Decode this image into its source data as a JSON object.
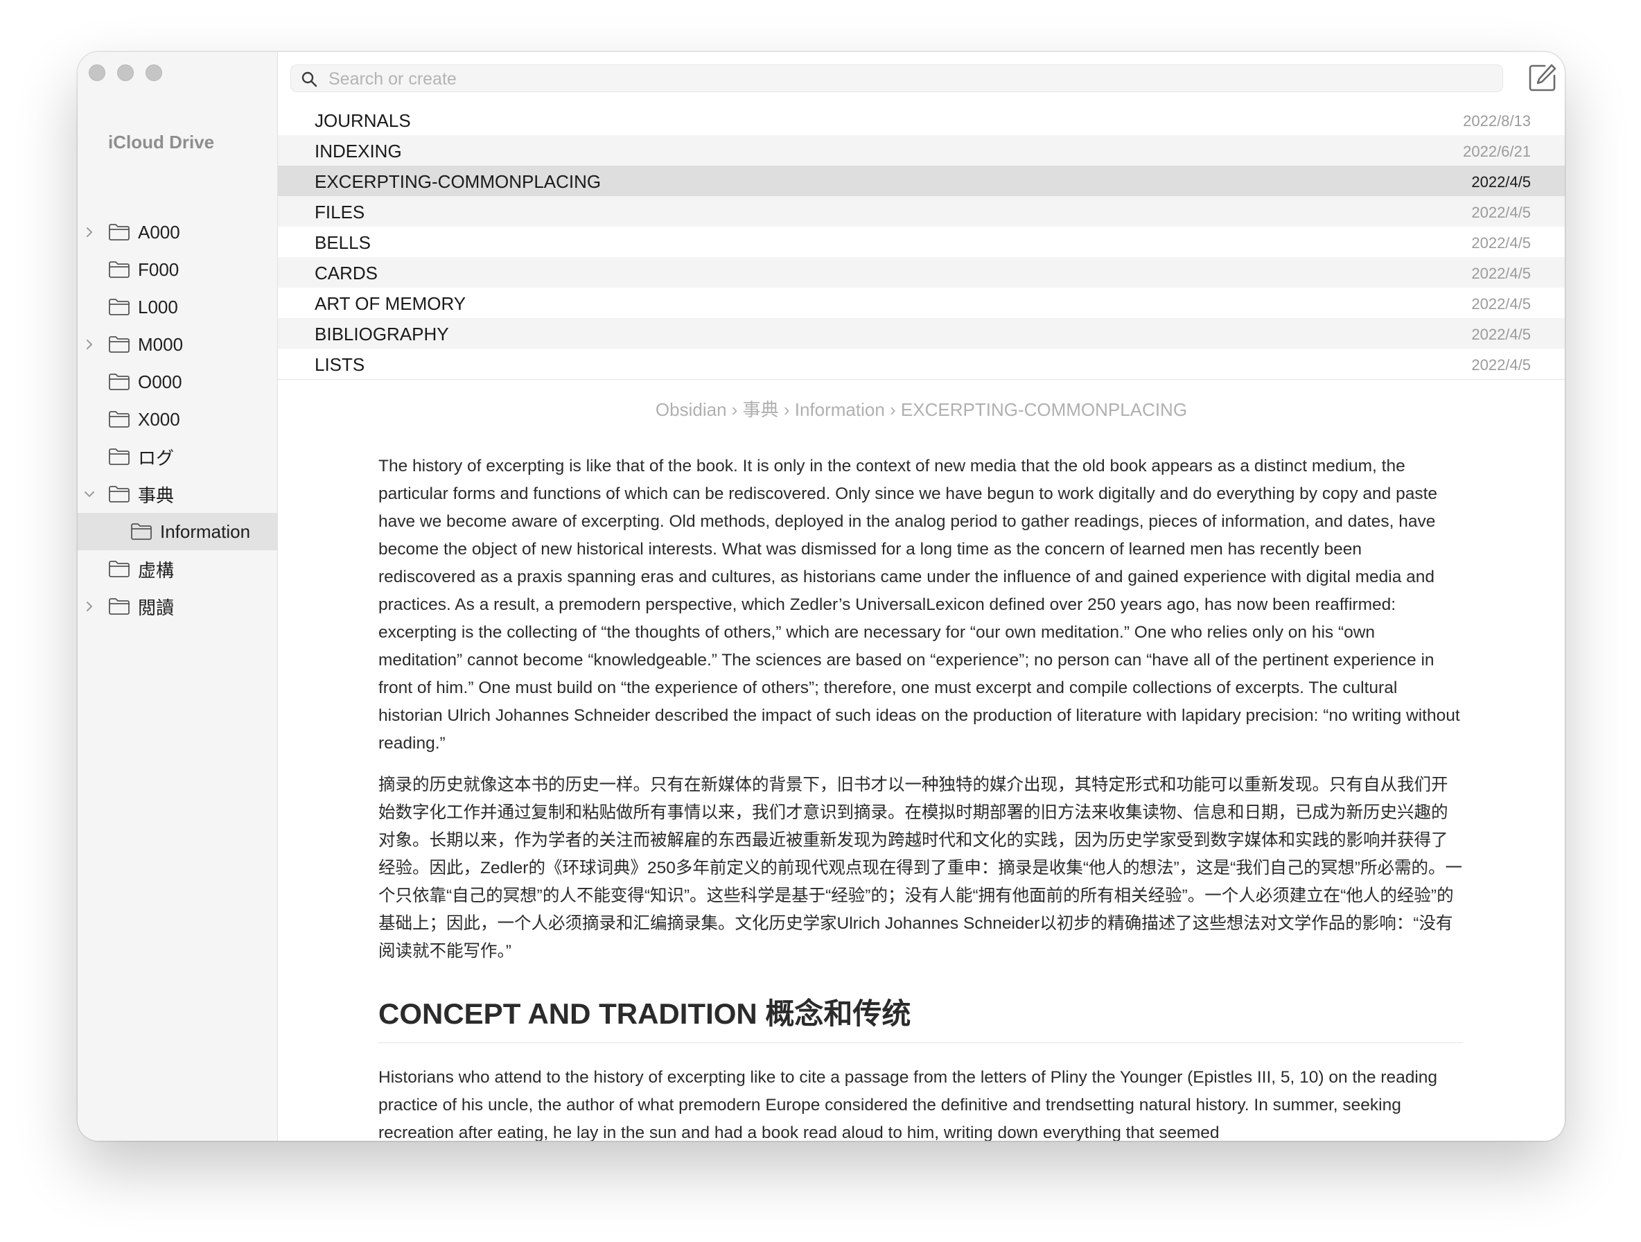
{
  "window": {
    "sidebar": {
      "title": "iCloud Drive",
      "folders": [
        {
          "label": "A000",
          "chevron": "right"
        },
        {
          "label": "F000",
          "chevron": ""
        },
        {
          "label": "L000",
          "chevron": ""
        },
        {
          "label": "M000",
          "chevron": "right"
        },
        {
          "label": "O000",
          "chevron": ""
        },
        {
          "label": "X000",
          "chevron": ""
        },
        {
          "label": "ログ",
          "chevron": ""
        },
        {
          "label": "事典",
          "chevron": "down"
        },
        {
          "label": "Information",
          "chevron": "",
          "selected": true
        },
        {
          "label": "虚構",
          "chevron": ""
        },
        {
          "label": "閲讀",
          "chevron": "right"
        }
      ]
    },
    "search": {
      "placeholder": "Search or create"
    },
    "notes": [
      {
        "title": "JOURNALS",
        "date": "2022/8/13"
      },
      {
        "title": "INDEXING",
        "date": "2022/6/21"
      },
      {
        "title": "EXCERPTING-COMMONPLACING",
        "date": "2022/4/5",
        "selected": true
      },
      {
        "title": "FILES",
        "date": "2022/4/5"
      },
      {
        "title": "BELLS",
        "date": "2022/4/5"
      },
      {
        "title": "CARDS",
        "date": "2022/4/5"
      },
      {
        "title": "ART OF MEMORY",
        "date": "2022/4/5"
      },
      {
        "title": "BIBLIOGRAPHY",
        "date": "2022/4/5"
      },
      {
        "title": "LISTS",
        "date": "2022/4/5"
      }
    ],
    "breadcrumb": "Obsidian › 事典 › Information › EXCERPTING-COMMONPLACING",
    "document": {
      "paragraph1": "The history of excerpting is like that of the book. It is only in the context of new media that the old book appears as a distinct medium, the particular forms and functions of which can be rediscovered. Only since we have begun to work digitally and do everything by copy and paste have we become aware of excerpting. Old methods, deployed in the analog period to gather readings, pieces of information, and dates, have become the object of new historical interests. What was dismissed for a long time as the concern of learned men has recently been rediscovered as a praxis spanning eras and cultures, as historians came under the influence of and gained experience with digital media and practices. As a result, a premodern perspective, which Zedler’s UniversalLexicon defined over 250 years ago, has now been reaffirmed: excerpting is the collecting of “the thoughts of others,” which are necessary for “our own meditation.” One who relies only on his “own meditation” cannot become “knowledgeable.” The sciences are based on “experience”; no person can “have all of the pertinent experience in front of him.” One must build on “the experience of others”; therefore, one must excerpt and compile collections of excerpts. The cultural historian Ulrich Johannes Schneider described the impact of such ideas on the production of literature with lapidary precision: “no writing without reading.”",
      "paragraph2": "摘录的历史就像这本书的历史一样。只有在新媒体的背景下，旧书才以一种独特的媒介出现，其特定形式和功能可以重新发现。只有自从我们开始数字化工作并通过复制和粘贴做所有事情以来，我们才意识到摘录。在模拟时期部署的旧方法来收集读物、信息和日期，已成为新历史兴趣的对象。长期以来，作为学者的关注而被解雇的东西最近被重新发现为跨越时代和文化的实践，因为历史学家受到数字媒体和实践的影响并获得了经验。因此，Zedler的《环球词典》250多年前定义的前现代观点现在得到了重申：摘录是收集“他人的想法”，这是“我们自己的冥想”所必需的。一个只依靠“自己的冥想”的人不能变得“知识”。这些科学是基于“经验”的；没有人能“拥有他面前的所有相关经验”。一个人必须建立在“他人的经验”的基础上；因此，一个人必须摘录和汇编摘录集。文化历史学家Ulrich Johannes Schneider以初步的精确描述了这些想法对文学作品的影响：“没有阅读就不能写作。”",
      "heading": "CONCEPT AND TRADITION 概念和传统",
      "paragraph3": "Historians who attend to the history of excerpting like to cite a passage from the letters of Pliny the Younger (Epistles III, 5, 10) on the reading practice of his uncle, the author of what premodern Europe considered the definitive and trendsetting natural history. In summer, seeking recreation after eating, he lay in the sun and had a book read aloud to him, writing down everything that seemed"
    }
  }
}
